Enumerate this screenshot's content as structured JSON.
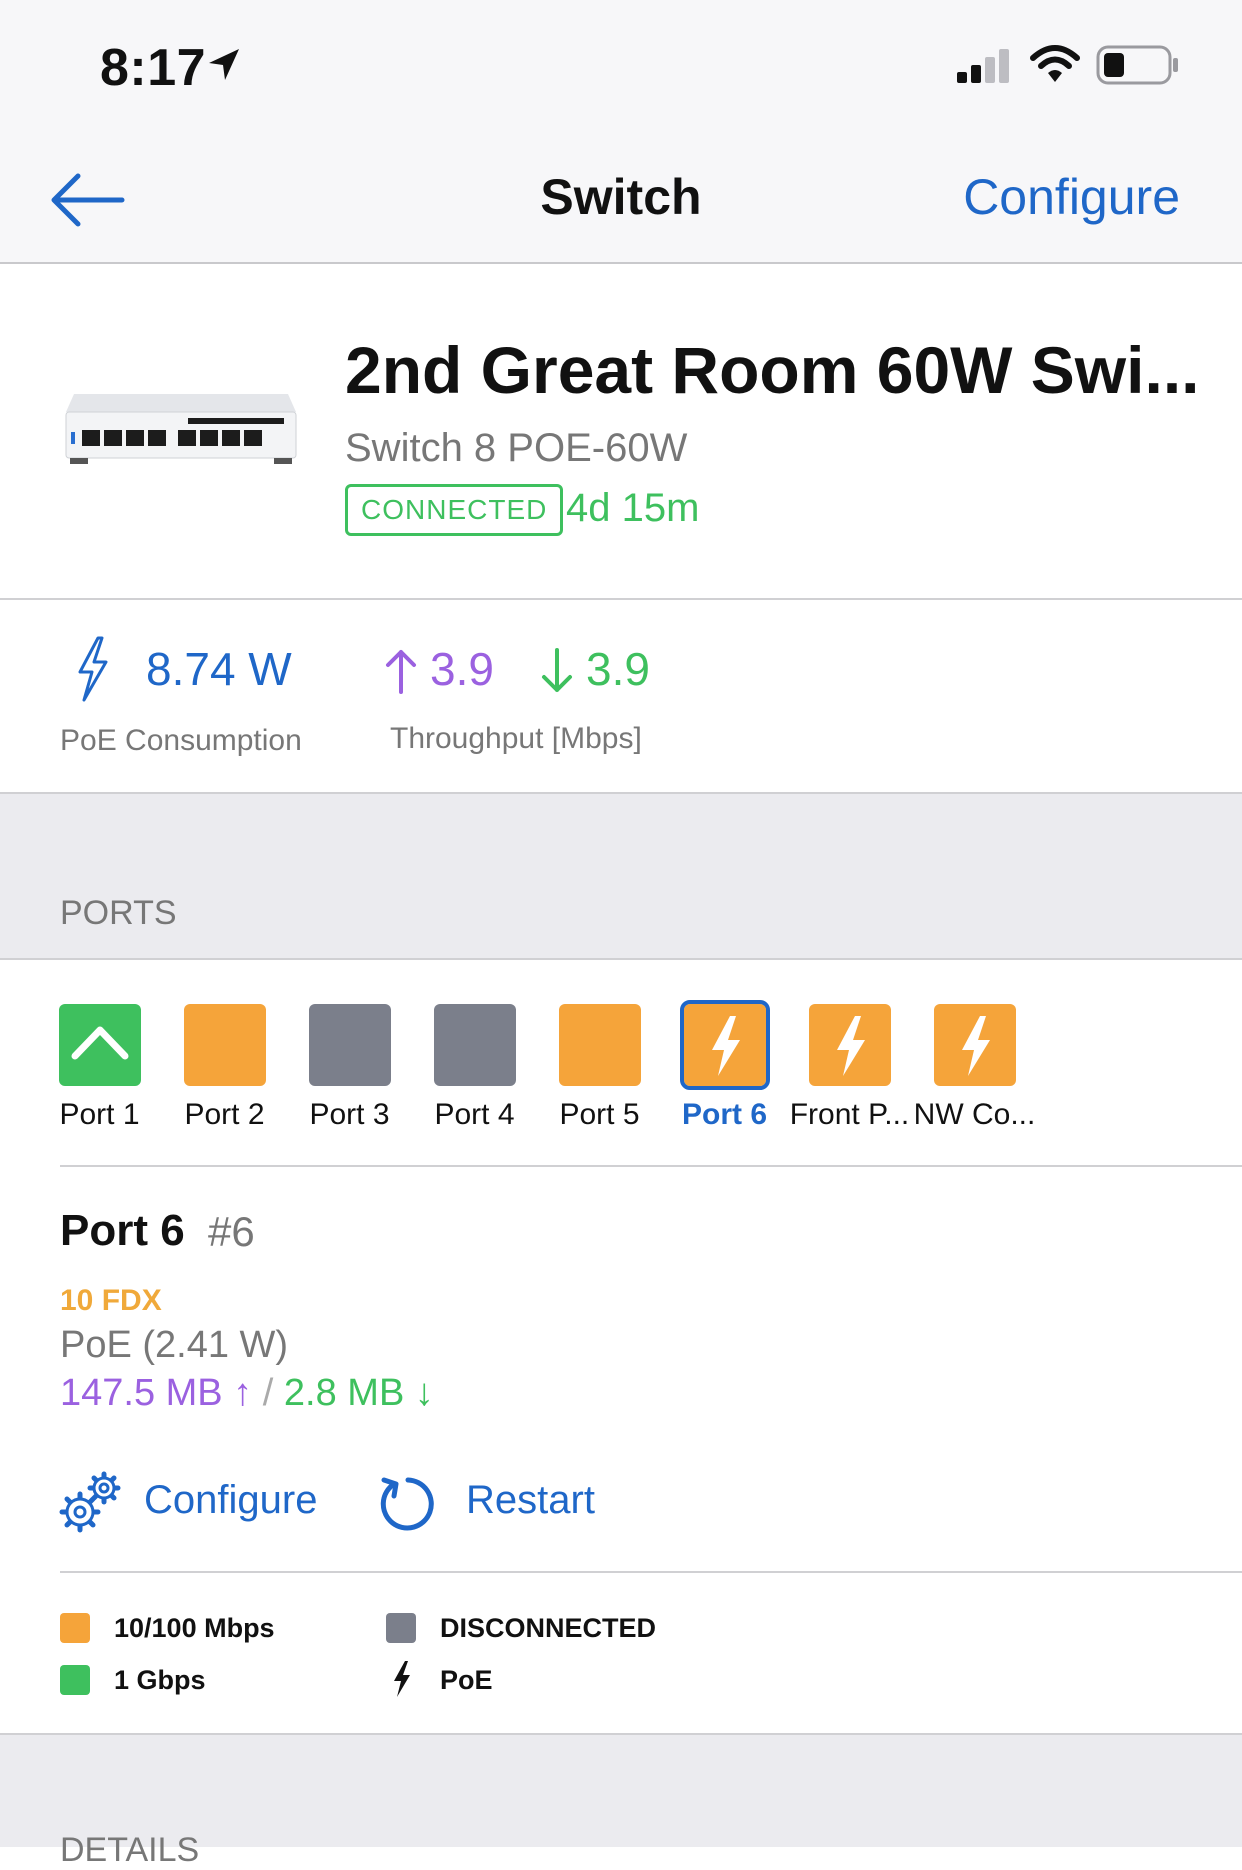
{
  "status_bar": {
    "time": "8:17"
  },
  "nav": {
    "title": "Switch",
    "configure": "Configure"
  },
  "device": {
    "name": "2nd Great Room 60W Swi...",
    "model": "Switch 8 POE-60W",
    "status": "CONNECTED",
    "uptime": "4d 15m"
  },
  "stats": {
    "poe_value": "8.74 W",
    "poe_label": "PoE Consumption",
    "up_value": "3.9",
    "down_value": "3.9",
    "throughput_label": "Throughput [Mbps]"
  },
  "ports_section": {
    "title": "PORTS"
  },
  "ports": [
    {
      "label": "Port 1",
      "state": "1 Gbps",
      "color": "#3ec05e",
      "icon": "uplink-icon"
    },
    {
      "label": "Port 2",
      "state": "10/100 Mbps",
      "color": "#f5a43a",
      "icon": ""
    },
    {
      "label": "Port 3",
      "state": "DISCONNECTED",
      "color": "#7b7f8b",
      "icon": ""
    },
    {
      "label": "Port 4",
      "state": "DISCONNECTED",
      "color": "#7b7f8b",
      "icon": ""
    },
    {
      "label": "Port 5",
      "state": "10/100 Mbps",
      "color": "#f5a43a",
      "icon": ""
    },
    {
      "label": "Port 6",
      "state": "10/100 Mbps",
      "color": "#f5a43a",
      "icon": "poe-bolt-icon",
      "selected": true
    },
    {
      "label": "Front P...",
      "state": "10/100 Mbps",
      "color": "#f5a43a",
      "icon": "poe-bolt-icon"
    },
    {
      "label": "NW Co...",
      "state": "10/100 Mbps",
      "color": "#f5a43a",
      "icon": "poe-bolt-icon"
    }
  ],
  "port_detail": {
    "title": "Port 6",
    "number": "#6",
    "speed": "10 FDX",
    "poe": "PoE (2.41 W)",
    "tx": "147.5 MB ↑",
    "separator": "/",
    "rx": "2.8 MB ↓",
    "configure": "Configure",
    "restart": "Restart"
  },
  "legend": {
    "speed_100": "10/100 Mbps",
    "speed_1g": "1 Gbps",
    "disconnected": "DISCONNECTED",
    "poe": "PoE"
  },
  "details_section": {
    "title": "DETAILS"
  },
  "colors": {
    "accent_blue": "#1f67c8",
    "green": "#3ec05e",
    "orange": "#f5a43a",
    "gray": "#7b7f8b",
    "purple": "#9b61e0"
  }
}
